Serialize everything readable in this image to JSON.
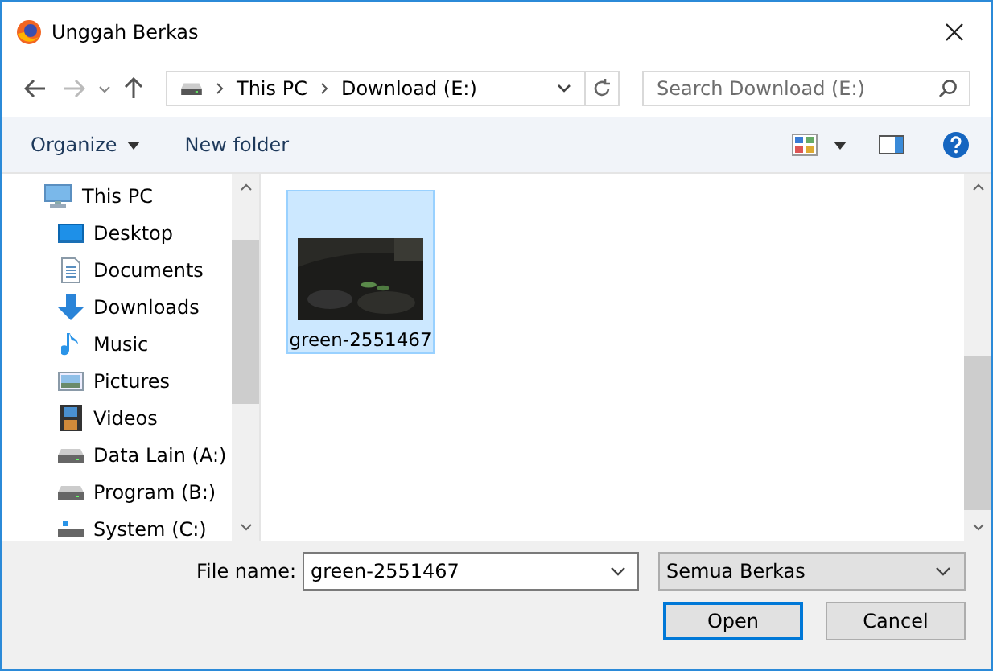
{
  "window": {
    "title": "Unggah Berkas"
  },
  "address": {
    "crumbs": [
      "This PC",
      "Download (E:)"
    ]
  },
  "search": {
    "placeholder": "Search Download (E:)"
  },
  "toolbar": {
    "organize": "Organize",
    "new_folder": "New folder"
  },
  "sidebar": {
    "items": [
      {
        "label": "This PC",
        "kind": "pc",
        "children": [
          {
            "label": "Desktop",
            "kind": "desktop"
          },
          {
            "label": "Documents",
            "kind": "documents"
          },
          {
            "label": "Downloads",
            "kind": "downloads"
          },
          {
            "label": "Music",
            "kind": "music"
          },
          {
            "label": "Pictures",
            "kind": "pictures"
          },
          {
            "label": "Videos",
            "kind": "videos"
          },
          {
            "label": "Data Lain (A:)",
            "kind": "drive"
          },
          {
            "label": "Program (B:)",
            "kind": "drive"
          },
          {
            "label": "System (C:)",
            "kind": "windows"
          }
        ]
      }
    ]
  },
  "files": [
    {
      "name": "green-2551467",
      "kind": "picture",
      "selected": true
    }
  ],
  "file_name": {
    "label": "File name:",
    "value": "green-2551467"
  },
  "file_type": {
    "value": "Semua Berkas"
  },
  "buttons": [
    {
      "label": "Open",
      "kind": "primary"
    },
    {
      "label": "Cancel",
      "kind": "normal"
    }
  ]
}
